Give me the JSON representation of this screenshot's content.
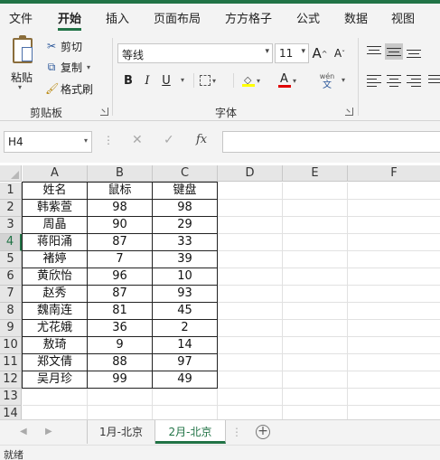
{
  "menu": {
    "tabs": [
      {
        "label": "文件"
      },
      {
        "label": "开始"
      },
      {
        "label": "插入"
      },
      {
        "label": "页面布局"
      },
      {
        "label": "方方格子"
      },
      {
        "label": "公式"
      },
      {
        "label": "数据"
      },
      {
        "label": "视图"
      }
    ],
    "active": "开始"
  },
  "ribbon": {
    "clipboard": {
      "paste": "粘贴",
      "cut": "剪切",
      "copy": "复制",
      "format_painter": "格式刷",
      "group_label": "剪贴板"
    },
    "font": {
      "font_name": "等线",
      "font_size": "11",
      "bold": "B",
      "italic": "I",
      "underline": "U",
      "grow": "A",
      "shrink": "A",
      "font_color_glyph": "A",
      "phonetic_top": "wén",
      "phonetic_bottom": "文",
      "group_label": "字体"
    }
  },
  "formula_bar": {
    "name_box": "H4",
    "cancel": "✕",
    "enter": "✓",
    "fx": "fx",
    "content": ""
  },
  "sheet": {
    "columns": [
      "A",
      "B",
      "C",
      "D",
      "E",
      "F"
    ],
    "rows": [
      "1",
      "2",
      "3",
      "4",
      "5",
      "6",
      "7",
      "8",
      "9",
      "10",
      "11",
      "12",
      "13",
      "14"
    ],
    "selected_row": "4",
    "table": [
      [
        "姓名",
        "鼠标",
        "键盘"
      ],
      [
        "韩紫萱",
        "98",
        "98"
      ],
      [
        "周晶",
        "90",
        "29"
      ],
      [
        "蒋阳涌",
        "87",
        "33"
      ],
      [
        "褚婷",
        "7",
        "39"
      ],
      [
        "黄欣怡",
        "96",
        "10"
      ],
      [
        "赵秀",
        "87",
        "93"
      ],
      [
        "魏南连",
        "81",
        "45"
      ],
      [
        "尤花娥",
        "36",
        "2"
      ],
      [
        "敖琦",
        "9",
        "14"
      ],
      [
        "郑文倩",
        "88",
        "97"
      ],
      [
        "吴月珍",
        "99",
        "49"
      ]
    ]
  },
  "sheet_tabs": [
    {
      "label": "1月-北京"
    },
    {
      "label": "2月-北京"
    }
  ],
  "active_sheet": "2月-北京",
  "status": "就绪",
  "colors": {
    "accent": "#217346"
  }
}
